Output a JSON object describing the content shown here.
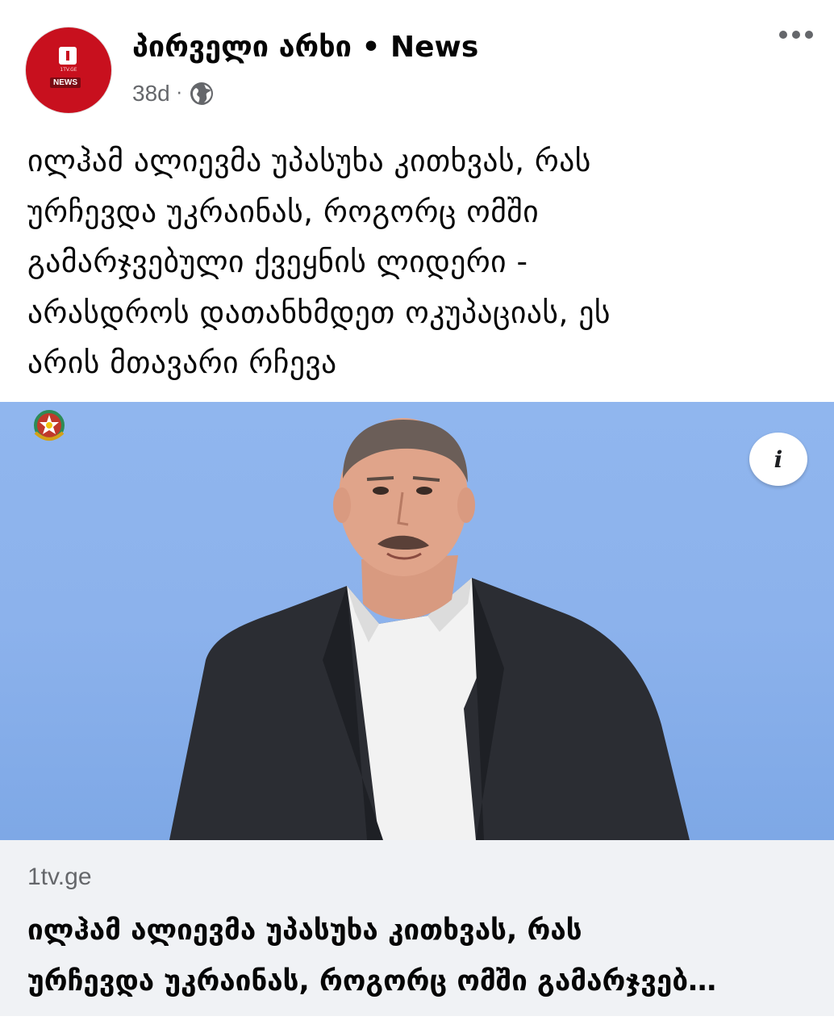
{
  "post": {
    "page_name": "პირველი არხი • News",
    "time": "38d",
    "dot": "·",
    "avatar_label": "NEWS",
    "avatar_sublabel": "1TV.GE",
    "text_lines": [
      "ილჰამ ალიევმა უპასუხა კითხვას, რას",
      "ურჩევდა უკრაინას, როგორც ომში",
      "გამარჯვებული ქვეყნის ლიდერი -",
      "არასდროს დათანხმდეთ ოკუპაციას, ეს",
      "არის მთავარი რჩევა"
    ],
    "info_label": "i"
  },
  "link": {
    "domain": "1tv.ge",
    "title_line1": "ილჰამ ალიევმა უპასუხა კითხვას, რას",
    "title_line2": "ურჩევდა უკრაინას, როგორც ომში გამარჯვებ…"
  },
  "colors": {
    "brand_red": "#c8101e",
    "meta_gray": "#65676b",
    "photo_blue": "#8cb2ec",
    "card_bg": "#f0f2f5"
  },
  "icons": [
    "globe-icon",
    "more-options-icon",
    "info-icon",
    "emblem-icon"
  ]
}
